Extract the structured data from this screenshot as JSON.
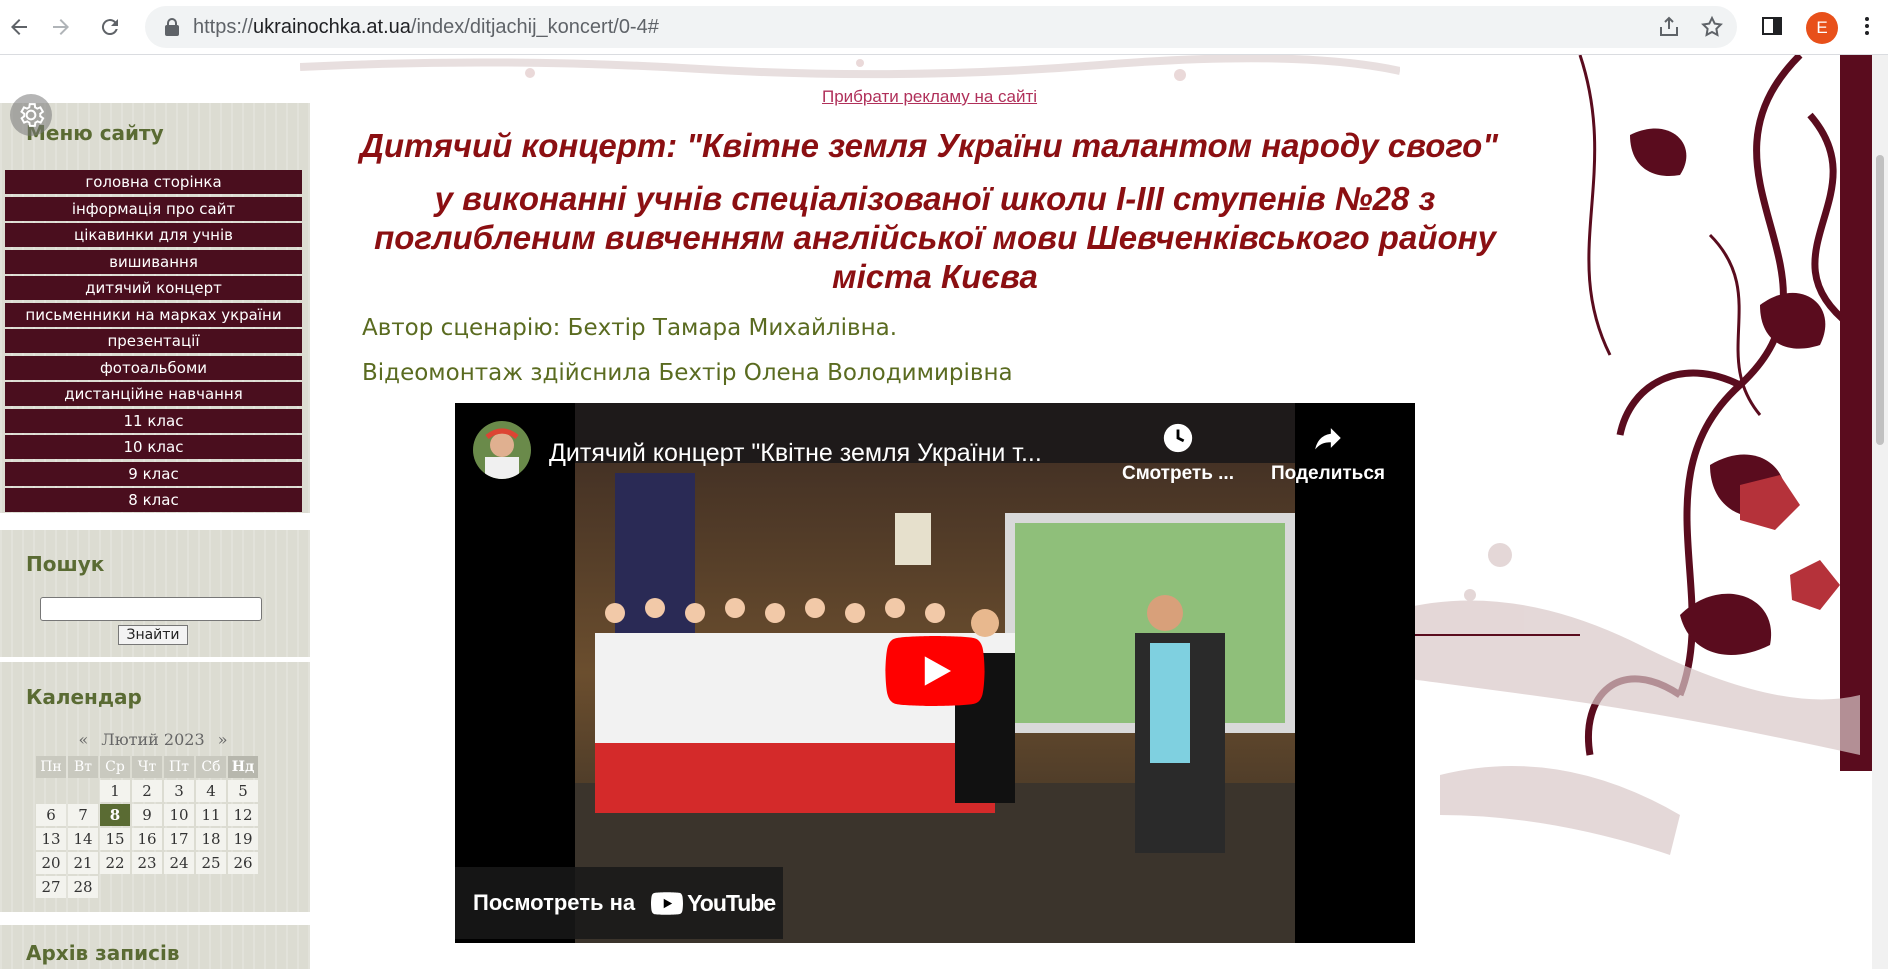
{
  "browser": {
    "url_host": "ukrainochka.at.ua",
    "url_prefix": "https://",
    "url_path": "/index/ditjachij_koncert/0-4#",
    "profile_initial": "E",
    "icons": [
      "back-arrow-icon",
      "forward-arrow-icon",
      "reload-icon",
      "lock-icon",
      "share-icon",
      "star-icon",
      "side-panel-icon",
      "more-vert-icon"
    ]
  },
  "sidebar": {
    "menu_title": "Меню сайту",
    "menu_items": [
      "головна сторінка",
      "інформація про сайт",
      "цікавинки для учнів",
      "вишивання",
      "дитячий концерт",
      "письменники на марках україни",
      "презентації",
      "фотоальбоми",
      "дистанційне навчання",
      "11 клас",
      "10 клас",
      "9 клас",
      "8 клас"
    ],
    "search_title": "Пошук",
    "search_value": "",
    "search_button": "Знайти",
    "calendar_title": "Календар",
    "calendar_prev": "«",
    "calendar_month": "Лютий 2023",
    "calendar_next": "»",
    "calendar_weekdays": [
      "Пн",
      "Вт",
      "Ср",
      "Чт",
      "Пт",
      "Сб",
      "Нд"
    ],
    "calendar_weeks": [
      [
        "",
        "",
        "1",
        "2",
        "3",
        "4",
        "5"
      ],
      [
        "6",
        "7",
        "8",
        "9",
        "10",
        "11",
        "12"
      ],
      [
        "13",
        "14",
        "15",
        "16",
        "17",
        "18",
        "19"
      ],
      [
        "20",
        "21",
        "22",
        "23",
        "24",
        "25",
        "26"
      ],
      [
        "27",
        "28",
        "",
        "",
        "",
        "",
        ""
      ]
    ],
    "calendar_today": "8",
    "archive_title": "Архів записів"
  },
  "content": {
    "remove_ads_link": "Прибрати рекламу на сайті",
    "title_line1": "Дитячий концерт: \"Квітне земля України талантом народу свого\"",
    "title_line2": "у виконанні учнів спеціалізованої школи І-ІІІ ступенів №28 з поглибленим вивченням англійської мови Шевченківського району міста Києва",
    "author": "Автор сценарію: Бехтір Тамара Михайлівна.",
    "video_editor": "Відеомонтаж здійснила Бехтір Олена Володимирівна"
  },
  "video": {
    "title": "Дитячий концерт \"Квітне земля України т...",
    "watch_later": "Смотреть ...",
    "share": "Поделиться",
    "watch_on": "Посмотреть на",
    "youtube": "YouTube",
    "accent": "#ff0000"
  },
  "colors": {
    "menu_bg": "#4a0e1e",
    "title": "#8b0f12",
    "author": "#5a6b20",
    "block_title": "#5a6b33"
  }
}
